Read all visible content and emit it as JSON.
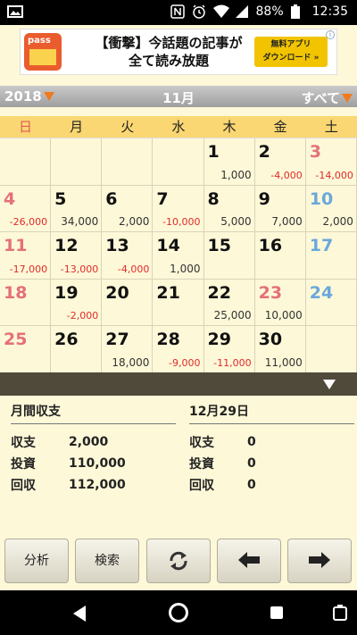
{
  "status_bar": {
    "battery": "88%",
    "time": "12:35",
    "icons": [
      "image-icon",
      "nfc-icon",
      "alarm-icon",
      "wifi-icon",
      "signal-icon",
      "battery-icon"
    ]
  },
  "ad": {
    "logo_text": "pass",
    "headline_line1": "【衝撃】今話題の記事が",
    "headline_line2": "全て読み放題",
    "cta_line1": "無料アプリ",
    "cta_line2": "ダウンロード »",
    "info_icon": "i"
  },
  "month_bar": {
    "year": "2018",
    "month": "11月",
    "filter": "すべて"
  },
  "weekdays": [
    "日",
    "月",
    "火",
    "水",
    "木",
    "金",
    "土"
  ],
  "calendar": {
    "cells": [
      {
        "day": "",
        "amount": "",
        "neg": false,
        "kind": ""
      },
      {
        "day": "",
        "amount": "",
        "neg": false,
        "kind": ""
      },
      {
        "day": "",
        "amount": "",
        "neg": false,
        "kind": ""
      },
      {
        "day": "",
        "amount": "",
        "neg": false,
        "kind": ""
      },
      {
        "day": "1",
        "amount": "1,000",
        "neg": false,
        "kind": ""
      },
      {
        "day": "2",
        "amount": "-4,000",
        "neg": true,
        "kind": ""
      },
      {
        "day": "3",
        "amount": "-14,000",
        "neg": true,
        "kind": "holiday"
      },
      {
        "day": "4",
        "amount": "-26,000",
        "neg": true,
        "kind": "sun"
      },
      {
        "day": "5",
        "amount": "34,000",
        "neg": false,
        "kind": ""
      },
      {
        "day": "6",
        "amount": "2,000",
        "neg": false,
        "kind": ""
      },
      {
        "day": "7",
        "amount": "-10,000",
        "neg": true,
        "kind": ""
      },
      {
        "day": "8",
        "amount": "5,000",
        "neg": false,
        "kind": ""
      },
      {
        "day": "9",
        "amount": "7,000",
        "neg": false,
        "kind": ""
      },
      {
        "day": "10",
        "amount": "2,000",
        "neg": false,
        "kind": "sat"
      },
      {
        "day": "11",
        "amount": "-17,000",
        "neg": true,
        "kind": "sun"
      },
      {
        "day": "12",
        "amount": "-13,000",
        "neg": true,
        "kind": ""
      },
      {
        "day": "13",
        "amount": "-4,000",
        "neg": true,
        "kind": ""
      },
      {
        "day": "14",
        "amount": "1,000",
        "neg": false,
        "kind": ""
      },
      {
        "day": "15",
        "amount": "",
        "neg": false,
        "kind": ""
      },
      {
        "day": "16",
        "amount": "",
        "neg": false,
        "kind": ""
      },
      {
        "day": "17",
        "amount": "",
        "neg": false,
        "kind": "sat"
      },
      {
        "day": "18",
        "amount": "",
        "neg": false,
        "kind": "sun"
      },
      {
        "day": "19",
        "amount": "-2,000",
        "neg": true,
        "kind": ""
      },
      {
        "day": "20",
        "amount": "",
        "neg": false,
        "kind": ""
      },
      {
        "day": "21",
        "amount": "",
        "neg": false,
        "kind": ""
      },
      {
        "day": "22",
        "amount": "25,000",
        "neg": false,
        "kind": ""
      },
      {
        "day": "23",
        "amount": "10,000",
        "neg": false,
        "kind": "holiday"
      },
      {
        "day": "24",
        "amount": "",
        "neg": false,
        "kind": "sat"
      },
      {
        "day": "25",
        "amount": "",
        "neg": false,
        "kind": "sun"
      },
      {
        "day": "26",
        "amount": "",
        "neg": false,
        "kind": ""
      },
      {
        "day": "27",
        "amount": "18,000",
        "neg": false,
        "kind": ""
      },
      {
        "day": "28",
        "amount": "-9,000",
        "neg": true,
        "kind": ""
      },
      {
        "day": "29",
        "amount": "-11,000",
        "neg": true,
        "kind": ""
      },
      {
        "day": "30",
        "amount": "11,000",
        "neg": false,
        "kind": ""
      },
      {
        "day": "",
        "amount": "",
        "neg": false,
        "kind": ""
      }
    ]
  },
  "summary_month": {
    "title": "月間収支",
    "rows": [
      {
        "label": "収支",
        "value": "2,000"
      },
      {
        "label": "投資",
        "value": "110,000"
      },
      {
        "label": "回収",
        "value": "112,000"
      }
    ]
  },
  "summary_day": {
    "title": "12月29日",
    "rows": [
      {
        "label": "収支",
        "value": "0"
      },
      {
        "label": "投資",
        "value": "0"
      },
      {
        "label": "回収",
        "value": "0"
      }
    ]
  },
  "buttons": {
    "analyze": "分析",
    "search": "検索",
    "sync_icon": "sync-icon",
    "prev_icon": "arrow-left-icon",
    "next_icon": "arrow-right-icon"
  },
  "colors": {
    "background": "#fdf8d8",
    "weekday_header": "#fbd773",
    "negative": "#e02a2a",
    "sunday": "#e4707a",
    "saturday": "#6aa8dc",
    "month_bar": "#b0b0b0",
    "accent_triangle": "#f07a1c"
  }
}
